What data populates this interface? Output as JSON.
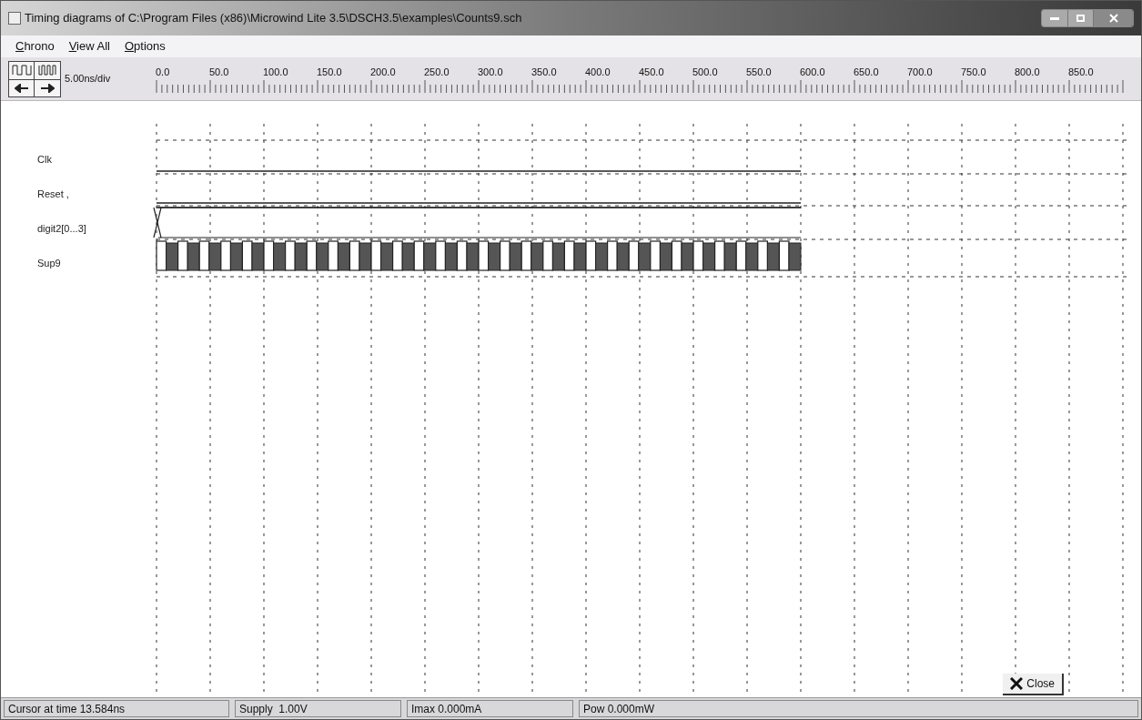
{
  "window": {
    "title": "Timing diagrams of C:\\Program Files (x86)\\Microwind Lite 3.5\\DSCH3.5\\examples\\Counts9.sch"
  },
  "menu": [
    "Chrono",
    "View All",
    "Options"
  ],
  "toolbar": {
    "scale": "5.00ns/div"
  },
  "ruler": {
    "labels": [
      "0.0",
      "50.0",
      "100.0",
      "150.0",
      "200.0",
      "250.0",
      "300.0",
      "350.0",
      "400.0",
      "450.0",
      "500.0",
      "550.0",
      "600.0",
      "650.0",
      "700.0",
      "750.0",
      "800.0",
      "850.0"
    ]
  },
  "signals": [
    {
      "name": "Clk",
      "kind": "low"
    },
    {
      "name": "Reset ,",
      "kind": "double"
    },
    {
      "name": "digit2[0...3]",
      "kind": "bus"
    },
    {
      "name": "Sup9",
      "kind": "clock"
    }
  ],
  "close_button": "Close",
  "status_bar": [
    "Cursor at time 13.584ns",
    "Supply  1.00V",
    "Imax 0.000mA",
    "Pow 0.000mW"
  ]
}
